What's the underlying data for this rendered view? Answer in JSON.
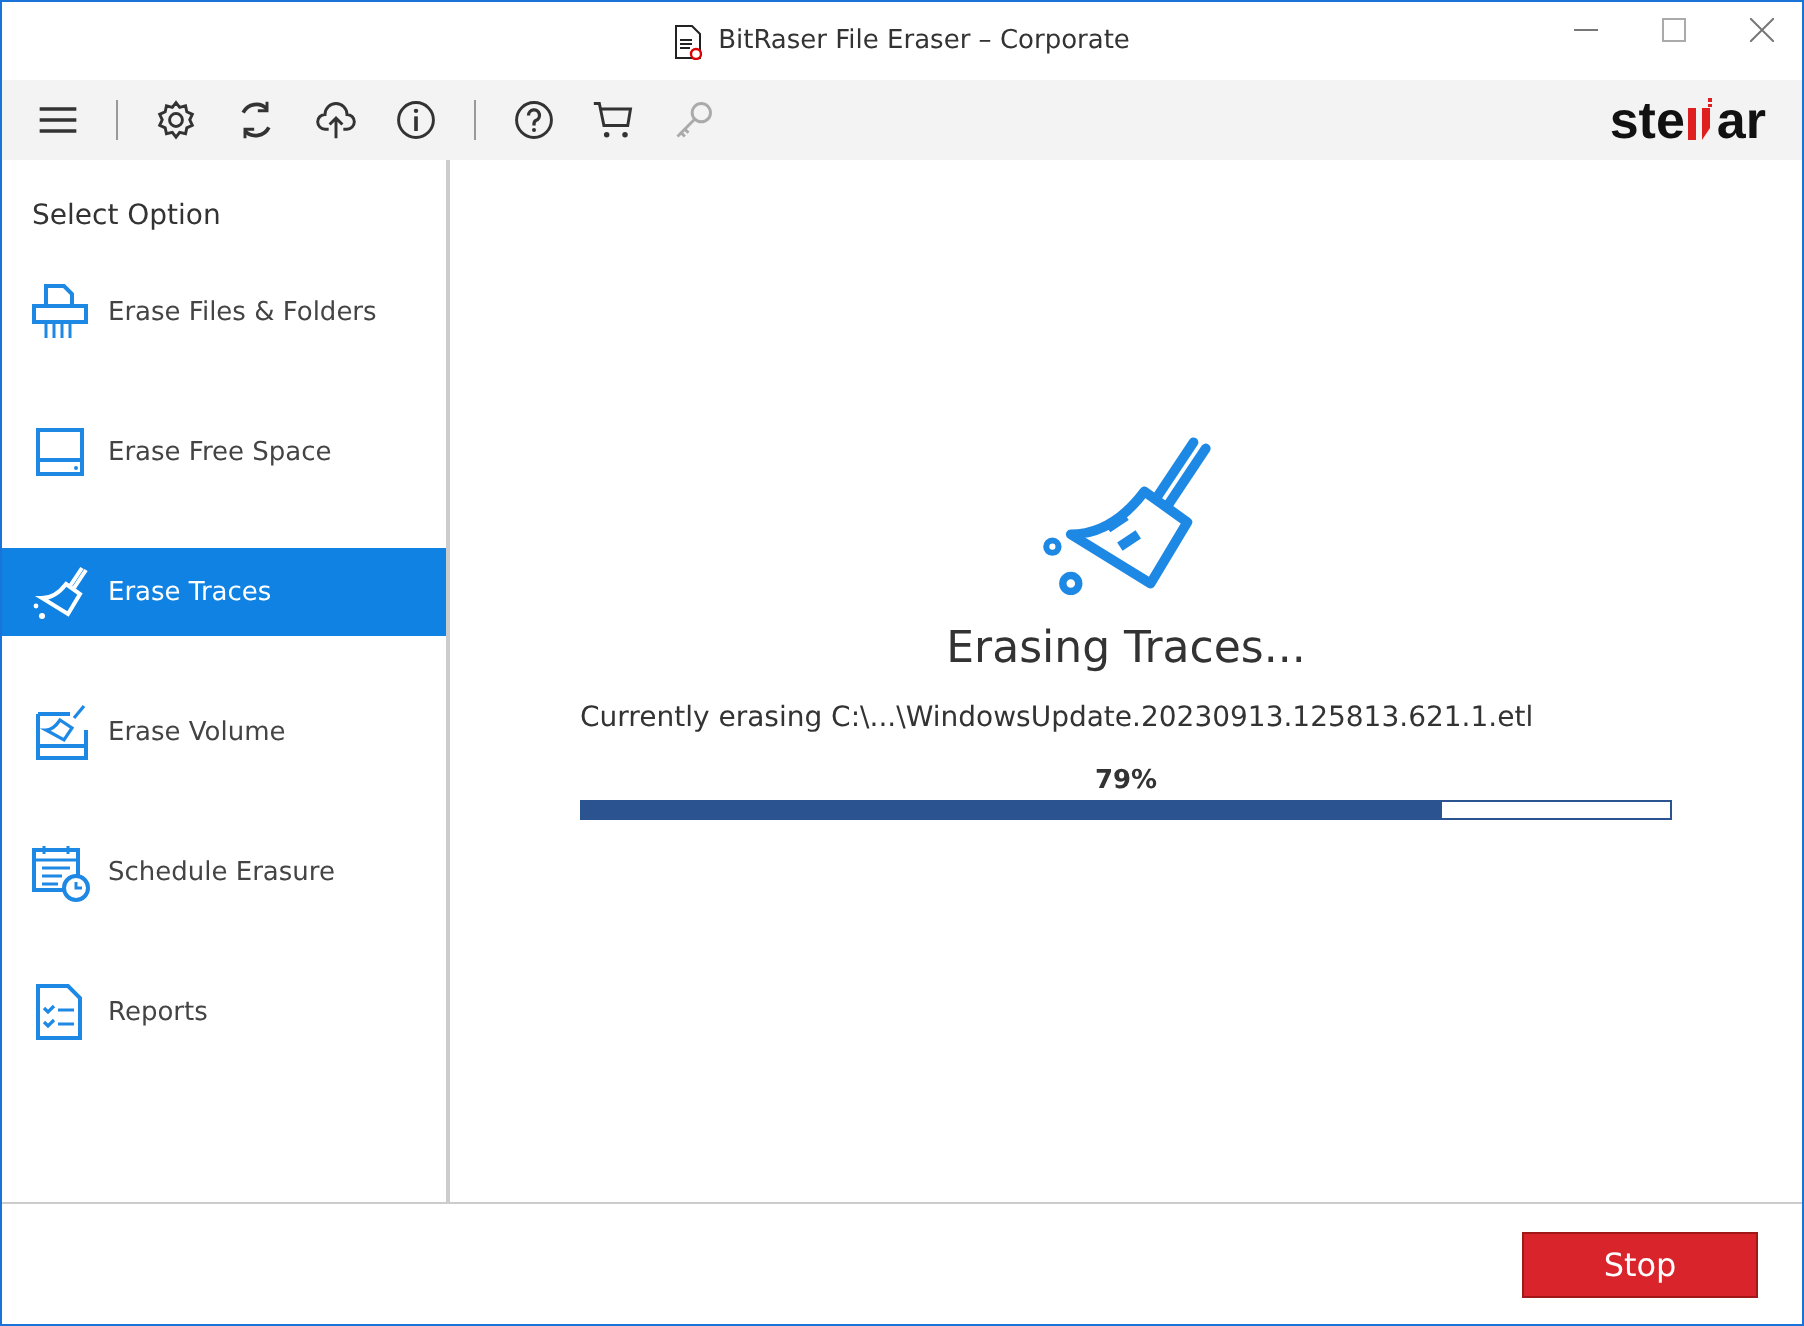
{
  "window": {
    "title": "BitRaser File Eraser – Corporate"
  },
  "toolbar": {
    "logo_start": "ste",
    "logo_end": "ar"
  },
  "sidebar": {
    "heading": "Select Option",
    "items": [
      {
        "kind": "files",
        "label": "Erase Files & Folders",
        "selected": false
      },
      {
        "kind": "drive",
        "label": "Erase Free Space",
        "selected": false
      },
      {
        "kind": "broom",
        "label": "Erase Traces",
        "selected": true
      },
      {
        "kind": "volume",
        "label": "Erase Volume",
        "selected": false
      },
      {
        "kind": "calendar",
        "label": "Schedule Erasure",
        "selected": false
      },
      {
        "kind": "report",
        "label": "Reports",
        "selected": false
      }
    ]
  },
  "progress": {
    "title": "Erasing Traces...",
    "status": "Currently erasing C:\\...\\WindowsUpdate.20230913.125813.621.1.etl",
    "percent": "79%",
    "level": 0.79
  },
  "buttons": [
    "Stop"
  ]
}
